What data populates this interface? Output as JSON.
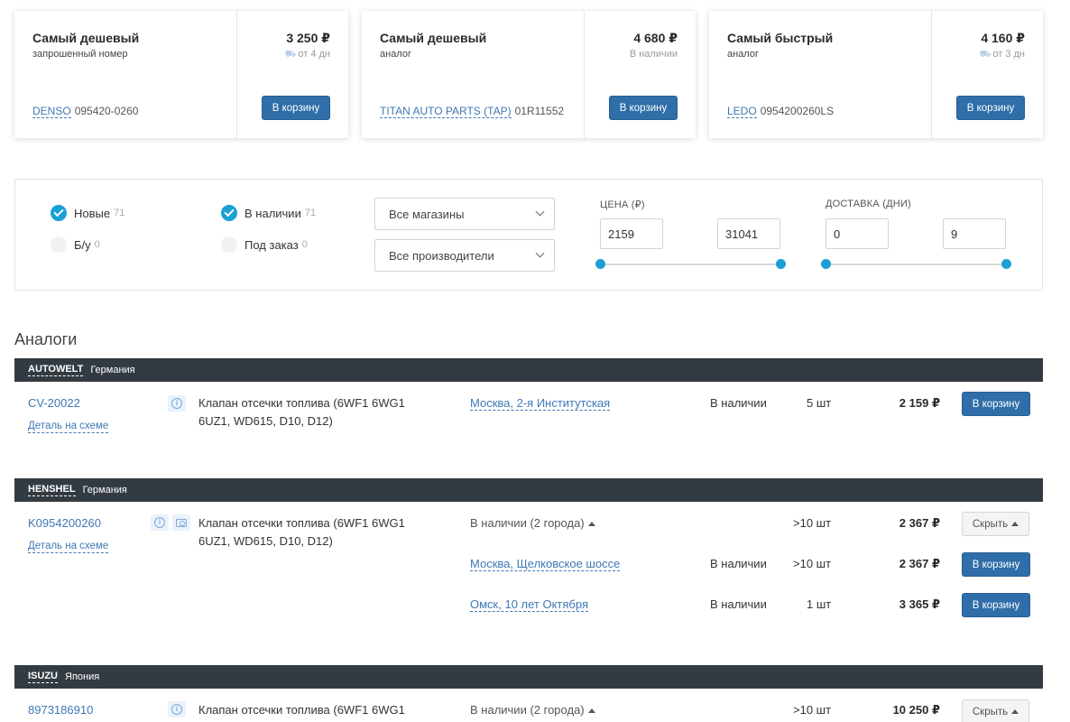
{
  "offers": [
    {
      "title": "Самый дешевый",
      "subtitle": "запрошенный номер",
      "brand": "DENSO",
      "code": "095420-0260",
      "price": "3 250 ₽",
      "availability": "от 4 дн",
      "availability_icon": "truck-icon",
      "button": "В корзину"
    },
    {
      "title": "Самый дешевый",
      "subtitle": "аналог",
      "brand": "TITAN AUTO PARTS (TAP)",
      "code": "01R11552",
      "price": "4 680 ₽",
      "availability": "В наличии",
      "availability_icon": "",
      "button": "В корзину"
    },
    {
      "title": "Самый быстрый",
      "subtitle": "аналог",
      "brand": "LEDO",
      "code": "0954200260LS",
      "price": "4 160 ₽",
      "availability": "от 3 дн",
      "availability_icon": "truck-icon",
      "button": "В корзину"
    }
  ],
  "filters": {
    "new": {
      "label": "Новые",
      "count": "71",
      "checked": true
    },
    "used": {
      "label": "Б/у",
      "count": "0",
      "checked": false
    },
    "in_stock": {
      "label": "В наличии",
      "count": "71",
      "checked": true
    },
    "on_order": {
      "label": "Под заказ",
      "count": "0",
      "checked": false
    },
    "stores_select": "Все магазины",
    "makers_select": "Все производители",
    "price": {
      "label": "ЦЕНА (₽)",
      "min": "2159",
      "max": "31041"
    },
    "delivery": {
      "label": "ДОСТАВКА (ДНИ)",
      "min": "0",
      "max": "9"
    },
    "accent_color": "#1aa0d6"
  },
  "analogs": {
    "title": "Аналоги",
    "groups": [
      {
        "brand": "AUTOWELT",
        "country": "Германия",
        "code": "CV-20022",
        "scheme_link": "Деталь на схеме",
        "description": "Клапан отсечки топлива (6WF1 6WG1 6UZ1, WD615, D10, D12)",
        "offers": [
          {
            "location": "Москва, 2-я Институтская",
            "status": "В наличии",
            "qty": "5 шт",
            "price": "2 159 ₽",
            "button": "В корзину"
          }
        ]
      },
      {
        "brand": "HENSHEL",
        "country": "Германия",
        "code": "K0954200260",
        "scheme_link": "Деталь на схеме",
        "description": "Клапан отсечки топлива (6WF1 6WG1 6UZ1, WD615, D10, D12)",
        "summary": {
          "label": "В наличии (2 города)",
          "qty": ">10 шт",
          "price": "2 367 ₽",
          "button": "Скрыть"
        },
        "offers": [
          {
            "location": "Москва, Щелковское шоссе",
            "status": "В наличии",
            "qty": ">10 шт",
            "price": "2 367 ₽",
            "button": "В корзину"
          },
          {
            "location": "Омск, 10 лет Октября",
            "status": "В наличии",
            "qty": "1 шт",
            "price": "3 365 ₽",
            "button": "В корзину"
          }
        ]
      },
      {
        "brand": "ISUZU",
        "country": "Япония",
        "code": "8973186910",
        "description": "Клапан отсечки топлива (6WF1 6WG1",
        "summary": {
          "label": "В наличии (2 города)",
          "qty": ">10 шт",
          "price": "10 250 ₽",
          "button": "Скрыть"
        }
      }
    ]
  }
}
